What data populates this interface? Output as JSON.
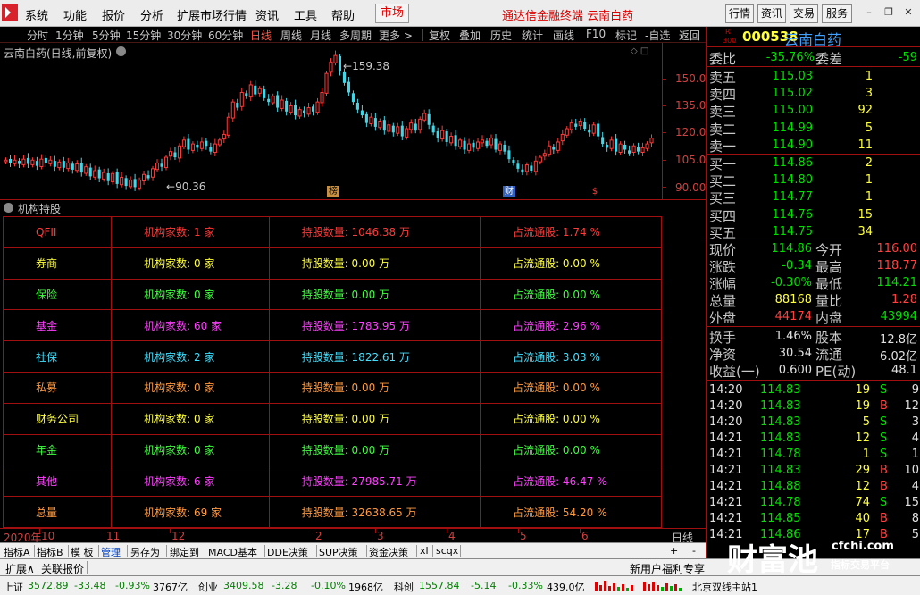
{
  "menubar": {
    "items": [
      "系统",
      "功能",
      "报价",
      "分析",
      "扩展市场行情",
      "资讯",
      "工具",
      "帮助"
    ],
    "market": "市场",
    "title": "通达信金融终端  云南白药",
    "buttons": [
      "行情",
      "资讯",
      "交易",
      "服务"
    ]
  },
  "periods": [
    "分时",
    "1分钟",
    "5分钟",
    "15分钟",
    "30分钟",
    "60分钟",
    "日线",
    "周线",
    "月线",
    "多周期",
    "更多 >"
  ],
  "active_period": "日线",
  "tools": [
    "复权",
    "叠加",
    "历史",
    "统计",
    "画线",
    "F10",
    "标记",
    "-自选",
    "返回"
  ],
  "chart": {
    "title": "云南白药(日线,前复权)",
    "high_label": "159.38",
    "low_label": "90.36",
    "y_ticks": [
      "150.0",
      "135.0",
      "120.0",
      "105.0",
      "90.00"
    ],
    "events": [
      "榜",
      "财",
      "$"
    ]
  },
  "chart_data": {
    "type": "candlestick",
    "ylim": [
      84,
      166
    ],
    "high": 159.38,
    "low": 90.36,
    "y_ticks": [
      150.0,
      135.0,
      120.0,
      105.0,
      90.0
    ],
    "x_ticks": [
      "2020年",
      "10",
      "11",
      "12",
      "2",
      "3",
      "4",
      "5",
      "6"
    ],
    "close": [
      104.5,
      103,
      104.5,
      102.5,
      105,
      102.5,
      104.5,
      101.5,
      105,
      103,
      104.5,
      101,
      103.5,
      100.5,
      103,
      99.5,
      102.5,
      98,
      101,
      96,
      99,
      95,
      98,
      93.5,
      97.5,
      92,
      95.5,
      91,
      94,
      90.36,
      94,
      97,
      95,
      100,
      103,
      101,
      106,
      109,
      106,
      112,
      115,
      110,
      113,
      111,
      114,
      112,
      109,
      113,
      115,
      118,
      127,
      135,
      132,
      140,
      138,
      144,
      139,
      142,
      137,
      135,
      138,
      132,
      136,
      130,
      133,
      128,
      131,
      129,
      132,
      130,
      135,
      140,
      150,
      156,
      159.38,
      151,
      145,
      140,
      135,
      131,
      128,
      124,
      127,
      122,
      125,
      120,
      123,
      119,
      122,
      117,
      121,
      124,
      120,
      126,
      129,
      123,
      119,
      116,
      120,
      114,
      117,
      112,
      115,
      110,
      113,
      111,
      114,
      115,
      112,
      116,
      110,
      113,
      109,
      105,
      103,
      100,
      98,
      102,
      99,
      104,
      106,
      108,
      112,
      110,
      114,
      118,
      121,
      124,
      122,
      125,
      121,
      119,
      123,
      117,
      113,
      111,
      115,
      109,
      113,
      110,
      108,
      112,
      109,
      111,
      113,
      116
    ]
  },
  "institutions": {
    "header": "机构持股",
    "rows": [
      {
        "cat": "QFII",
        "count": "机构家数: 1 家",
        "shares": "持股数量: 1046.38 万",
        "pct": "占流通股: 1.74 %",
        "color": "#ff3a3a"
      },
      {
        "cat": "券商",
        "count": "机构家数: 0 家",
        "shares": "持股数量: 0.00 万",
        "pct": "占流通股: 0.00 %",
        "color": "#ffff40"
      },
      {
        "cat": "保险",
        "count": "机构家数: 0 家",
        "shares": "持股数量: 0.00 万",
        "pct": "占流通股: 0.00 %",
        "color": "#40ff40"
      },
      {
        "cat": "基金",
        "count": "机构家数: 60 家",
        "shares": "持股数量: 1783.95 万",
        "pct": "占流通股: 2.96 %",
        "color": "#ff40ff"
      },
      {
        "cat": "社保",
        "count": "机构家数: 2 家",
        "shares": "持股数量: 1822.61 万",
        "pct": "占流通股: 3.03 %",
        "color": "#40e0ff"
      },
      {
        "cat": "私募",
        "count": "机构家数: 0 家",
        "shares": "持股数量: 0.00 万",
        "pct": "占流通股: 0.00 %",
        "color": "#ff9a40"
      },
      {
        "cat": "财务公司",
        "count": "机构家数: 0 家",
        "shares": "持股数量: 0.00 万",
        "pct": "占流通股: 0.00 %",
        "color": "#ffff40"
      },
      {
        "cat": "年金",
        "count": "机构家数: 0 家",
        "shares": "持股数量: 0.00 万",
        "pct": "占流通股: 0.00 %",
        "color": "#40ff40"
      },
      {
        "cat": "其他",
        "count": "机构家数: 6 家",
        "shares": "持股数量: 27985.71 万",
        "pct": "占流通股: 46.47 %",
        "color": "#ff40ff"
      },
      {
        "cat": "总量",
        "count": "机构家数: 69 家",
        "shares": "持股数量: 32638.65 万",
        "pct": "占流通股: 54.20 %",
        "color": "#ff9a40"
      }
    ]
  },
  "date_axis": {
    "ticks": [
      "2020年",
      "10",
      "11",
      "12",
      "2",
      "3",
      "4",
      "5",
      "6"
    ],
    "label": "日线"
  },
  "indicator_tabs": [
    "指标A",
    "指标B",
    "模 板",
    "管理",
    "另存为",
    "绑定到",
    "MACD基本",
    "DDE决策",
    "SUP决策",
    "资金决策",
    "xl",
    "scqx"
  ],
  "indicator_active": "管理",
  "indicator_buttons": [
    "+",
    "-"
  ],
  "bottom_tabs": [
    "扩展∧",
    "关联报价"
  ],
  "promo": "新用户福利专享",
  "status": {
    "sh_label": "上证",
    "sh_value": "3572.89",
    "sh_change": "-33.48",
    "sh_pct": "-0.93%",
    "sh_amount": "3767亿",
    "cy_label": "创业",
    "cy_value": "3409.58",
    "cy_change": "-3.28",
    "cy_pct": "-0.10%",
    "cy_amount": "1968亿",
    "kc_label": "科创",
    "kc_value": "1557.84",
    "kc_change": "-5.14",
    "kc_pct": "-0.33%",
    "kc_amount": "439.0亿",
    "server": "北京双线主站1"
  },
  "quote": {
    "badge_top": "R",
    "badge_bottom": "300",
    "code": "000538",
    "name": "云南白药",
    "weibi_label": "委比",
    "weibi": "-35.76%",
    "weicha_label": "委差",
    "weicha": "-59",
    "asks": [
      {
        "label": "卖五",
        "price": "115.03",
        "vol": "1"
      },
      {
        "label": "卖四",
        "price": "115.02",
        "vol": "3"
      },
      {
        "label": "卖三",
        "price": "115.00",
        "vol": "92"
      },
      {
        "label": "卖二",
        "price": "114.99",
        "vol": "5"
      },
      {
        "label": "卖一",
        "price": "114.90",
        "vol": "11"
      }
    ],
    "bids": [
      {
        "label": "买一",
        "price": "114.86",
        "vol": "2"
      },
      {
        "label": "买二",
        "price": "114.80",
        "vol": "1"
      },
      {
        "label": "买三",
        "price": "114.77",
        "vol": "1"
      },
      {
        "label": "买四",
        "price": "114.76",
        "vol": "15"
      },
      {
        "label": "买五",
        "price": "114.75",
        "vol": "34"
      }
    ],
    "stats": [
      {
        "l1": "现价",
        "v1": "114.86",
        "c1": "vg",
        "l2": "今开",
        "v2": "116.00",
        "c2": "vr"
      },
      {
        "l1": "涨跌",
        "v1": "-0.34",
        "c1": "vg",
        "l2": "最高",
        "v2": "118.77",
        "c2": "vr"
      },
      {
        "l1": "涨幅",
        "v1": "-0.30%",
        "c1": "vg",
        "l2": "最低",
        "v2": "114.21",
        "c2": "vg"
      },
      {
        "l1": "总量",
        "v1": "88168",
        "c1": "vy",
        "l2": "量比",
        "v2": "1.28",
        "c2": "vr"
      },
      {
        "l1": "外盘",
        "v1": "44174",
        "c1": "vr",
        "l2": "内盘",
        "v2": "43994",
        "c2": "vg"
      }
    ],
    "stats2": [
      {
        "l1": "换手",
        "v1": "1.46%",
        "l2": "股本",
        "v2": "12.8亿"
      },
      {
        "l1": "净资",
        "v1": "30.54",
        "l2": "流通",
        "v2": "6.02亿"
      },
      {
        "l1": "收益(一)",
        "v1": "0.600",
        "l2": "PE(动)",
        "v2": "48.1"
      }
    ],
    "ticks": [
      {
        "t": "14:20",
        "p": "114.83",
        "v": "19",
        "s": "S",
        "n": "9"
      },
      {
        "t": "14:20",
        "p": "114.83",
        "v": "19",
        "s": "B",
        "n": "12"
      },
      {
        "t": "14:20",
        "p": "114.83",
        "v": "5",
        "s": "S",
        "n": "3"
      },
      {
        "t": "14:21",
        "p": "114.83",
        "v": "12",
        "s": "S",
        "n": "4"
      },
      {
        "t": "14:21",
        "p": "114.78",
        "v": "1",
        "s": "S",
        "n": "1"
      },
      {
        "t": "14:21",
        "p": "114.83",
        "v": "29",
        "s": "B",
        "n": "10"
      },
      {
        "t": "14:21",
        "p": "114.88",
        "v": "12",
        "s": "B",
        "n": "4"
      },
      {
        "t": "14:21",
        "p": "114.78",
        "v": "74",
        "s": "S",
        "n": "15"
      },
      {
        "t": "14:21",
        "p": "114.85",
        "v": "40",
        "s": "B",
        "n": "8"
      },
      {
        "t": "14:21",
        "p": "114.86",
        "v": "17",
        "s": "B",
        "n": "5"
      }
    ]
  },
  "brand": {
    "name": "财富池",
    "url": "cfchi.com",
    "sub": "指标交易平台"
  }
}
